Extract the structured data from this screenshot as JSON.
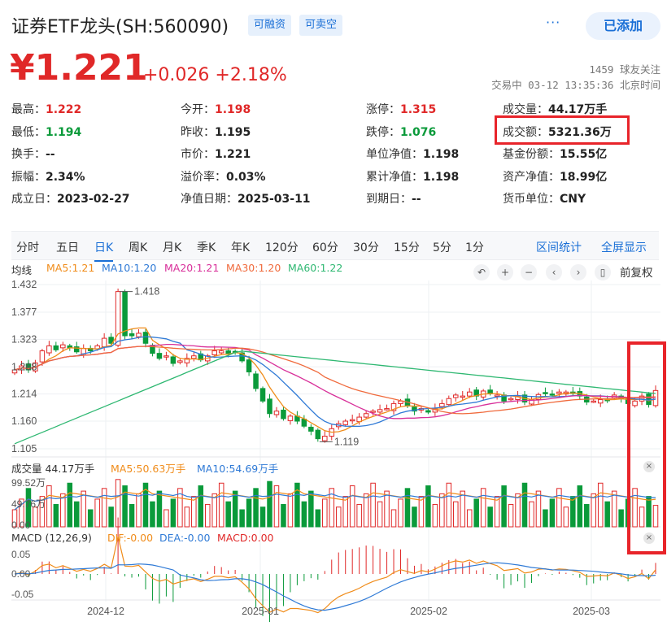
{
  "header": {
    "title": "证券ETF龙头(SH:560090)",
    "badges": [
      "可融资",
      "可卖空"
    ],
    "more": "···",
    "add_button": "已添加",
    "price": "¥1.221",
    "change": "+0.026  +2.18%",
    "followers": "1459 球友关注",
    "status": "交易中 03-12 13:35:36 北京时间"
  },
  "quote": [
    [
      {
        "label": "最高：",
        "value": "1.222",
        "color": "red"
      },
      {
        "label": "今开：",
        "value": "1.198",
        "color": "red"
      },
      {
        "label": "涨停：",
        "value": "1.315",
        "color": "red"
      },
      {
        "label": "成交量：",
        "value": "44.17万手",
        "color": ""
      }
    ],
    [
      {
        "label": "最低：",
        "value": "1.194",
        "color": "green"
      },
      {
        "label": "昨收：",
        "value": "1.195",
        "color": ""
      },
      {
        "label": "跌停：",
        "value": "1.076",
        "color": "green"
      },
      {
        "label": "成交额：",
        "value": "5321.36万",
        "color": ""
      }
    ],
    [
      {
        "label": "换手：",
        "value": "--",
        "color": ""
      },
      {
        "label": "市价：",
        "value": "1.221",
        "color": ""
      },
      {
        "label": "单位净值：",
        "value": "1.198",
        "color": ""
      },
      {
        "label": "基金份额：",
        "value": "15.55亿",
        "color": ""
      }
    ],
    [
      {
        "label": "振幅：",
        "value": "2.34%",
        "color": ""
      },
      {
        "label": "溢价率：",
        "value": "0.03%",
        "color": ""
      },
      {
        "label": "累计净值：",
        "value": "1.198",
        "color": ""
      },
      {
        "label": "资产净值：",
        "value": "18.99亿",
        "color": ""
      }
    ],
    [
      {
        "label": "成立日：",
        "value": "2023-02-27",
        "color": ""
      },
      {
        "label": "净值日期：",
        "value": "2025-03-11",
        "color": ""
      },
      {
        "label": "到期日：",
        "value": "--",
        "color": ""
      },
      {
        "label": "货币单位：",
        "value": "CNY",
        "color": ""
      }
    ]
  ],
  "tabs": [
    "分时",
    "五日",
    "日K",
    "周K",
    "月K",
    "季K",
    "年K",
    "120分",
    "60分",
    "30分",
    "15分",
    "5分",
    "1分"
  ],
  "active_tab": "日K",
  "tab_links": [
    "区间统计",
    "全屏显示"
  ],
  "kline_legend": {
    "label": "均线",
    "items": [
      {
        "text": "MA5:1.21",
        "color": "#f08c1a"
      },
      {
        "text": "MA10:1.20",
        "color": "#2f7ad6"
      },
      {
        "text": "MA20:1.21",
        "color": "#d8309a"
      },
      {
        "text": "MA30:1.20",
        "color": "#f06a3c"
      },
      {
        "text": "MA60:1.22",
        "color": "#2fb872"
      }
    ],
    "controls": [
      "↶",
      "+",
      "−",
      "‹",
      "›",
      "▯"
    ],
    "adjust": "前复权"
  },
  "vol_legend": {
    "label": "成交量 44.17万手",
    "items": [
      {
        "text": "MA5:50.63万手",
        "color": "#f08c1a"
      },
      {
        "text": "MA10:54.69万手",
        "color": "#2f7ad6"
      }
    ]
  },
  "macd_legend": {
    "label": "MACD (12,26,9)",
    "items": [
      {
        "text": "DIF:-0.00",
        "color": "#f08c1a"
      },
      {
        "text": "DEA:-0.00",
        "color": "#2f7ad6"
      },
      {
        "text": "MACD:0.00",
        "color": "#e02828"
      }
    ]
  },
  "close_icon": "×",
  "chart_data": {
    "type": "candlestick",
    "y_ticks": [
      "1.432",
      "1.377",
      "1.323",
      "1.268",
      "1.214",
      "1.160",
      "1.105"
    ],
    "y_range": [
      1.105,
      1.432
    ],
    "annotations": [
      {
        "text": "1.418",
        "value": 1.418
      },
      {
        "text": "1.119",
        "value": 1.119
      }
    ],
    "x_labels": [
      "2024-12",
      "2025-01",
      "2025-02",
      "2025-03"
    ],
    "closes": [
      1.262,
      1.27,
      1.262,
      1.276,
      1.3,
      1.31,
      1.302,
      1.312,
      1.306,
      1.298,
      1.305,
      1.3,
      1.31,
      1.325,
      1.315,
      1.418,
      1.33,
      1.33,
      1.335,
      1.315,
      1.295,
      1.285,
      1.29,
      1.275,
      1.28,
      1.285,
      1.29,
      1.282,
      1.29,
      1.3,
      1.3,
      1.295,
      1.298,
      1.28,
      1.258,
      1.225,
      1.2,
      1.175,
      1.18,
      1.165,
      1.17,
      1.16,
      1.15,
      1.14,
      1.125,
      1.13,
      1.145,
      1.155,
      1.16,
      1.163,
      1.168,
      1.175,
      1.18,
      1.183,
      1.185,
      1.195,
      1.2,
      1.19,
      1.18,
      1.185,
      1.178,
      1.185,
      1.195,
      1.205,
      1.212,
      1.21,
      1.218,
      1.21,
      1.22,
      1.215,
      1.212,
      1.2,
      1.205,
      1.21,
      1.198,
      1.203,
      1.213,
      1.216,
      1.213,
      1.218,
      1.218,
      1.215,
      1.21,
      1.198,
      1.2,
      1.203,
      1.202,
      1.212,
      1.205,
      1.195,
      1.2,
      1.21,
      1.193,
      1.221
    ],
    "volume_ticks": [
      "99.52万",
      "49.76万",
      "0.00"
    ],
    "macd_ticks": [
      "0.05",
      "0.00",
      "-0.05"
    ]
  }
}
